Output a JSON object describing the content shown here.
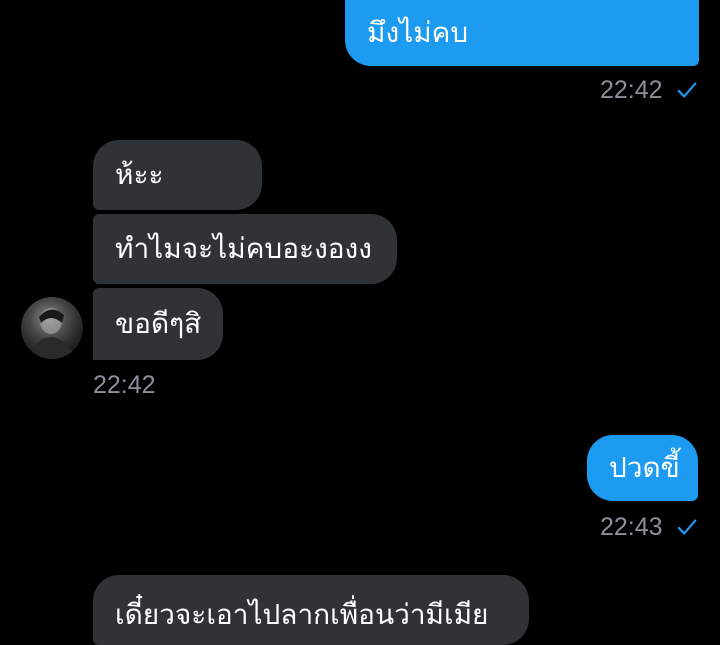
{
  "messages": {
    "out_1": {
      "text": "มึงไม่คบ",
      "time": "22:42"
    },
    "in_group": {
      "m1": "ห้ะะ",
      "m2": "ทำไมจะไม่คบอะงองง",
      "m3": "ขอดีๆสิ",
      "time": "22:42"
    },
    "out_2": {
      "text": "ปวดขี้",
      "time": "22:43"
    },
    "in_partial": {
      "text": "เดี๋ยวจะเอาไปลากเพื่อนว่ามีเมีย"
    }
  },
  "colors": {
    "outgoing_bubble": "#1d9bf0",
    "incoming_bubble": "#2f3336",
    "timestamp": "#8b9199",
    "read_check": "#1d9bf0",
    "background": "#000000"
  },
  "icons": {
    "read_receipt": "check-icon",
    "avatar": "contact-avatar"
  }
}
